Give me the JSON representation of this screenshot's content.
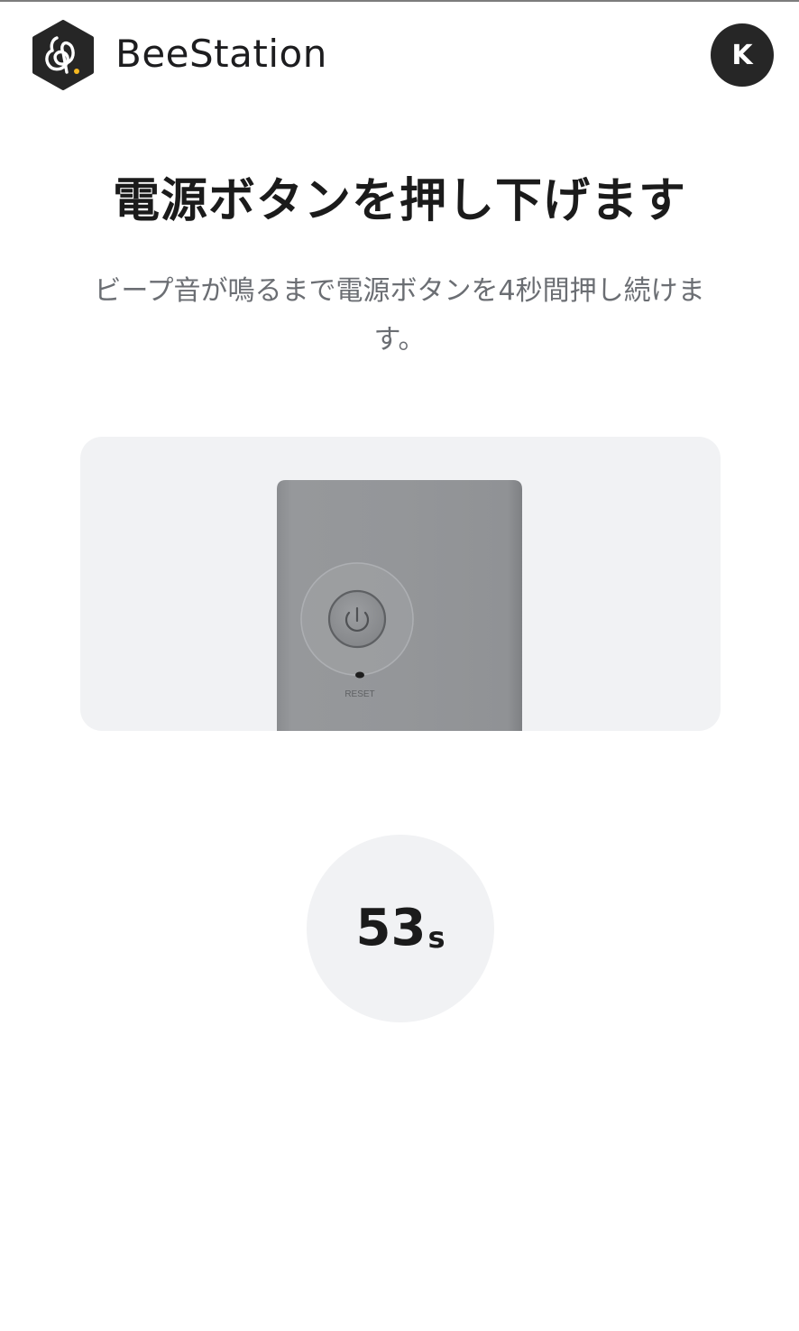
{
  "header": {
    "app_name": "BeeStation",
    "avatar_initial": "K"
  },
  "main": {
    "title": "電源ボタンを押し下げます",
    "description": "ビープ音が鳴るまで電源ボタンを4秒間押し続けます。",
    "illustration": {
      "icon": "power-icon",
      "reset_label": "RESET"
    },
    "timer": {
      "value": "53",
      "unit": "s"
    }
  },
  "colors": {
    "background": "#ffffff",
    "card_background": "#f1f2f4",
    "avatar_background": "#262626",
    "device_color": "#8f9194",
    "logo_accent": "#f5b820",
    "text_primary": "#1b1b1b",
    "text_secondary": "#6b6e73"
  }
}
